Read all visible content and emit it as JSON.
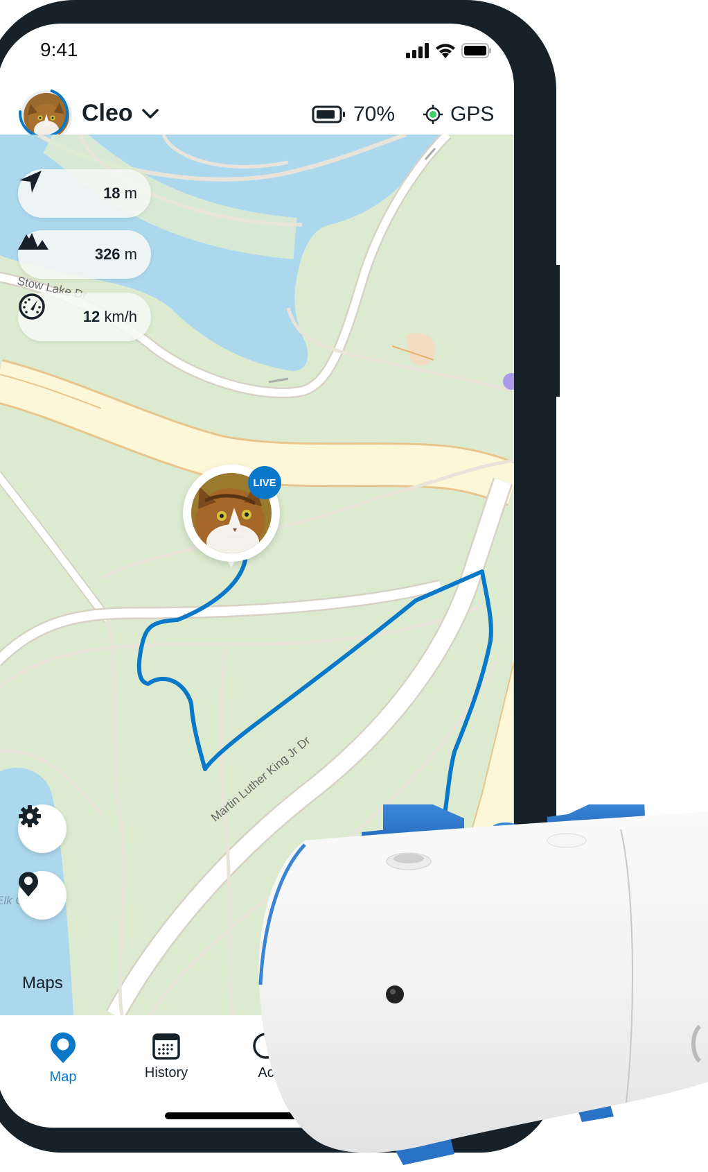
{
  "status_bar": {
    "time": "9:41",
    "icons": [
      "signal-icon",
      "wifi-icon",
      "battery-icon"
    ]
  },
  "header": {
    "pet_name": "Cleo",
    "pet_selector_icon": "chevron-down-icon",
    "battery_percent": "70%",
    "battery_level": 0.7,
    "gps_label": "GPS",
    "gps_status_color": "#3ecf6b"
  },
  "stats": [
    {
      "icon": "navigation-arrow-icon",
      "value": "18",
      "unit": "m"
    },
    {
      "icon": "mountains-icon",
      "value": "326",
      "unit": "m"
    },
    {
      "icon": "speedometer-icon",
      "value": "12",
      "unit": "km/h"
    }
  ],
  "map": {
    "street_labels": [
      "Stow Lake Dr",
      "Martin Luther King Jr Dr",
      "Elk Glen Lake"
    ],
    "live_badge": "LIVE",
    "route_color": "#0a78c8",
    "controls": [
      {
        "icon": "gear-icon",
        "label": "settings"
      },
      {
        "icon": "map-pin-icon",
        "label": "maps"
      }
    ],
    "maps_label": "Maps"
  },
  "tabbar": {
    "tabs": [
      {
        "label": "Map",
        "icon": "map-pin-icon",
        "active": true
      },
      {
        "label": "History",
        "icon": "calendar-icon",
        "active": false
      },
      {
        "label": "Ac",
        "icon": "activity-icon",
        "active": false
      }
    ]
  },
  "colors": {
    "accent": "#0a78c8",
    "frame": "#16212a",
    "map_green": "#dcebd0",
    "water": "#acd8ee",
    "highway": "#fcf7d8"
  }
}
